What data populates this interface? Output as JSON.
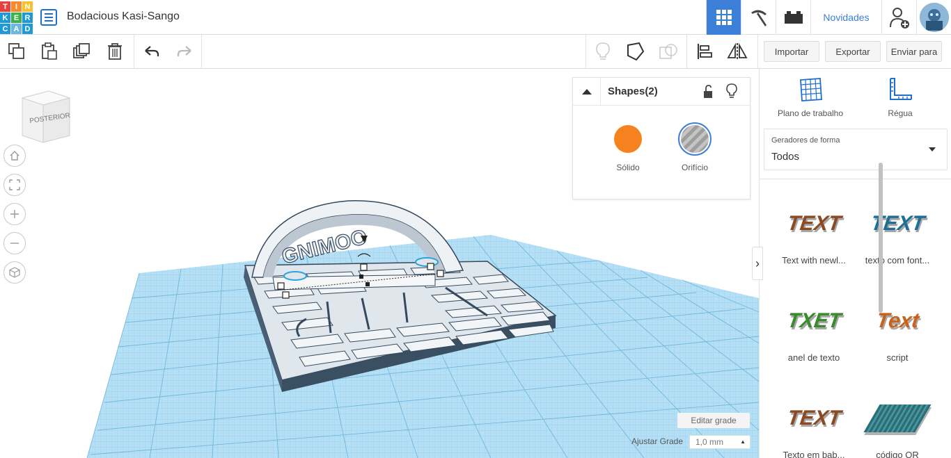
{
  "app": {
    "logo_letters": [
      "T",
      "I",
      "N",
      "K",
      "E",
      "R",
      "C",
      "A",
      "D"
    ],
    "logo_colors": [
      "#e8403a",
      "#f58c2b",
      "#f6c12c",
      "#1e9ad6",
      "#3bb34a",
      "#1e9ad6",
      "#1e9ad6",
      "#6cb7e0",
      "#1e9ad6"
    ],
    "document_title": "Bodacious Kasi-Sango",
    "novidades_label": "Novidades"
  },
  "toolbar": {
    "import_label": "Importar",
    "export_label": "Exportar",
    "send_label": "Enviar para"
  },
  "viewcube": {
    "face_label": "POSTERIOR"
  },
  "shape_panel": {
    "title": "Shapes(2)",
    "solid_label": "Sólido",
    "hole_label": "Orifício",
    "solid_color": "#f5821f"
  },
  "workplane": {
    "edit_grid_label": "Editar grade",
    "snap_grid_label": "Ajustar Grade",
    "snap_grid_value": "1,0 mm",
    "arch_text": "GNIMOO"
  },
  "sidebar": {
    "workplane_label": "Plano de trabalho",
    "ruler_label": "Régua",
    "dropdown_label": "Geradores de forma",
    "dropdown_value": "Todos",
    "items": [
      {
        "label": "Text with newl...",
        "thumb_text": "TEXT",
        "color": "#8b4a22"
      },
      {
        "label": "texto com font...",
        "thumb_text": "TEXT",
        "color": "#1d6f96"
      },
      {
        "label": "anel de texto",
        "thumb_text": "TXET",
        "color": "#3a8a2e"
      },
      {
        "label": "script",
        "thumb_text": "Text",
        "color": "#c8611a"
      },
      {
        "label": "Texto em bab...",
        "thumb_text": "TEXT",
        "color": "#8b4a22"
      },
      {
        "label": "código QR",
        "thumb_text": "",
        "color": "#2a6f78"
      }
    ]
  }
}
